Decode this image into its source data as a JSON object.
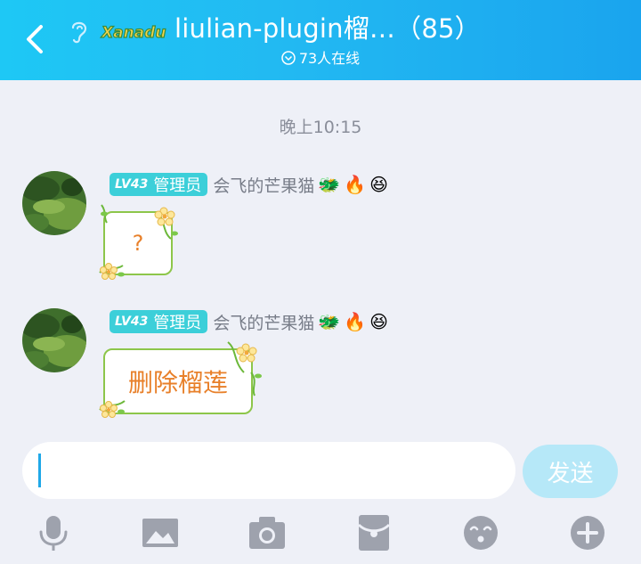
{
  "header": {
    "title": "liulian-plugin榴…（85）",
    "online": "73人在线",
    "logo_text": "Xanadu"
  },
  "timestamp": "晚上10:15",
  "messages": [
    {
      "level": "LV43",
      "role": "管理员",
      "nickname": "会飞的芒果猫",
      "badges": [
        "🐲",
        "🔥",
        "😆"
      ],
      "text": "?"
    },
    {
      "level": "LV43",
      "role": "管理员",
      "nickname": "会飞的芒果猫",
      "badges": [
        "🐲",
        "🔥",
        "😆"
      ],
      "text": "删除榴莲"
    }
  ],
  "input": {
    "value": "",
    "placeholder": ""
  },
  "send_label": "发送",
  "toolbar": [
    "microphone-icon",
    "image-icon",
    "camera-icon",
    "red-packet-icon",
    "emoji-icon",
    "plus-icon"
  ],
  "colors": {
    "header_start": "#1ec8f5",
    "header_end": "#1aa4ee",
    "background": "#eef0f7",
    "level_tag": "#3ccfd9",
    "bubble_text": "#e8802a",
    "send_button": "#b6e8f8",
    "toolbar_icon": "#9ea2ad"
  }
}
